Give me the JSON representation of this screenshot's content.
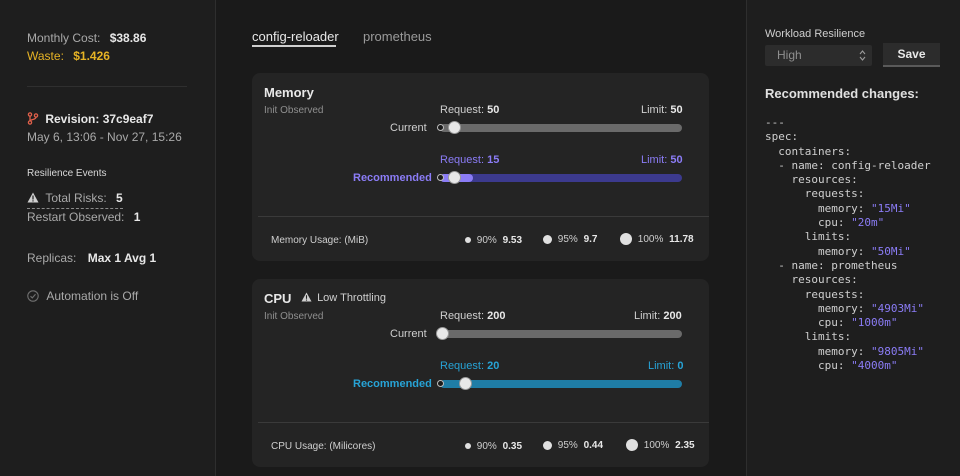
{
  "sidebar": {
    "monthly_cost_label": "Monthly Cost:",
    "monthly_cost_value": "$38.86",
    "waste_label": "Waste:",
    "waste_value": "$1.426",
    "revision_label": "Revision: 37c9eaf7",
    "date_range": "May 6, 13:06 - Nov 27, 15:26",
    "resilience_events_title": "Resilience Events",
    "total_risks_label": "Total Risks:",
    "total_risks_value": "5",
    "restart_observed_label": "Restart Observed:",
    "restart_observed_value": "1",
    "replicas_label": "Replicas:",
    "replicas_value": "Max 1 Avg 1",
    "automation_label": "Automation is Off"
  },
  "tabs": [
    {
      "label": "config-reloader",
      "active": true
    },
    {
      "label": "prometheus",
      "active": false
    }
  ],
  "memory": {
    "title": "Memory",
    "subtitle": "Init Observed",
    "current_label": "Current",
    "current_request_label": "Request:",
    "current_request_value": "50",
    "current_limit_label": "Limit:",
    "current_limit_value": "50",
    "recommended_label": "Recommended",
    "rec_request_label": "Request:",
    "rec_request_value": "15",
    "rec_limit_label": "Limit:",
    "rec_limit_value": "50",
    "usage_label": "Memory Usage: (MiB)",
    "p90_label": "90%",
    "p90_value": "9.53",
    "p95_label": "95%",
    "p95_value": "9.7",
    "p100_label": "100%",
    "p100_value": "11.78"
  },
  "cpu": {
    "title": "CPU",
    "throttling_label": "Low Throttling",
    "subtitle": "Init Observed",
    "current_label": "Current",
    "current_request_label": "Request:",
    "current_request_value": "200",
    "current_limit_label": "Limit:",
    "current_limit_value": "200",
    "recommended_label": "Recommended",
    "rec_request_label": "Request:",
    "rec_request_value": "20",
    "rec_limit_label": "Limit:",
    "rec_limit_value": "0",
    "usage_label": "CPU Usage: (Milicores)",
    "p90_label": "90%",
    "p90_value": "0.35",
    "p95_label": "95%",
    "p95_value": "0.44",
    "p100_label": "100%",
    "p100_value": "2.35"
  },
  "right_panel": {
    "resilience_title": "Workload Resilience",
    "resilience_selected": "High",
    "save_label": "Save",
    "recommended_changes_title": "Recommended changes:",
    "yaml_lines": [
      {
        "text": "---",
        "str": ""
      },
      {
        "text": "spec:",
        "str": ""
      },
      {
        "text": "  containers:",
        "str": ""
      },
      {
        "text": "  - name: config-reloader",
        "str": ""
      },
      {
        "text": "    resources:",
        "str": ""
      },
      {
        "text": "      requests:",
        "str": ""
      },
      {
        "text": "        memory: ",
        "str": "\"15Mi\""
      },
      {
        "text": "        cpu: ",
        "str": "\"20m\""
      },
      {
        "text": "      limits:",
        "str": ""
      },
      {
        "text": "        memory: ",
        "str": "\"50Mi\""
      },
      {
        "text": "  - name: prometheus",
        "str": ""
      },
      {
        "text": "    resources:",
        "str": ""
      },
      {
        "text": "      requests:",
        "str": ""
      },
      {
        "text": "        memory: ",
        "str": "\"4903Mi\""
      },
      {
        "text": "        cpu: ",
        "str": "\"1000m\""
      },
      {
        "text": "      limits:",
        "str": ""
      },
      {
        "text": "        memory: ",
        "str": "\"9805Mi\""
      },
      {
        "text": "        cpu: ",
        "str": "\"4000m\""
      }
    ]
  },
  "colors": {
    "accent_purple": "#8b7cf6",
    "accent_blue": "#27a3d6",
    "waste_yellow": "#e6b325",
    "revision_icon": "#e0604a"
  }
}
